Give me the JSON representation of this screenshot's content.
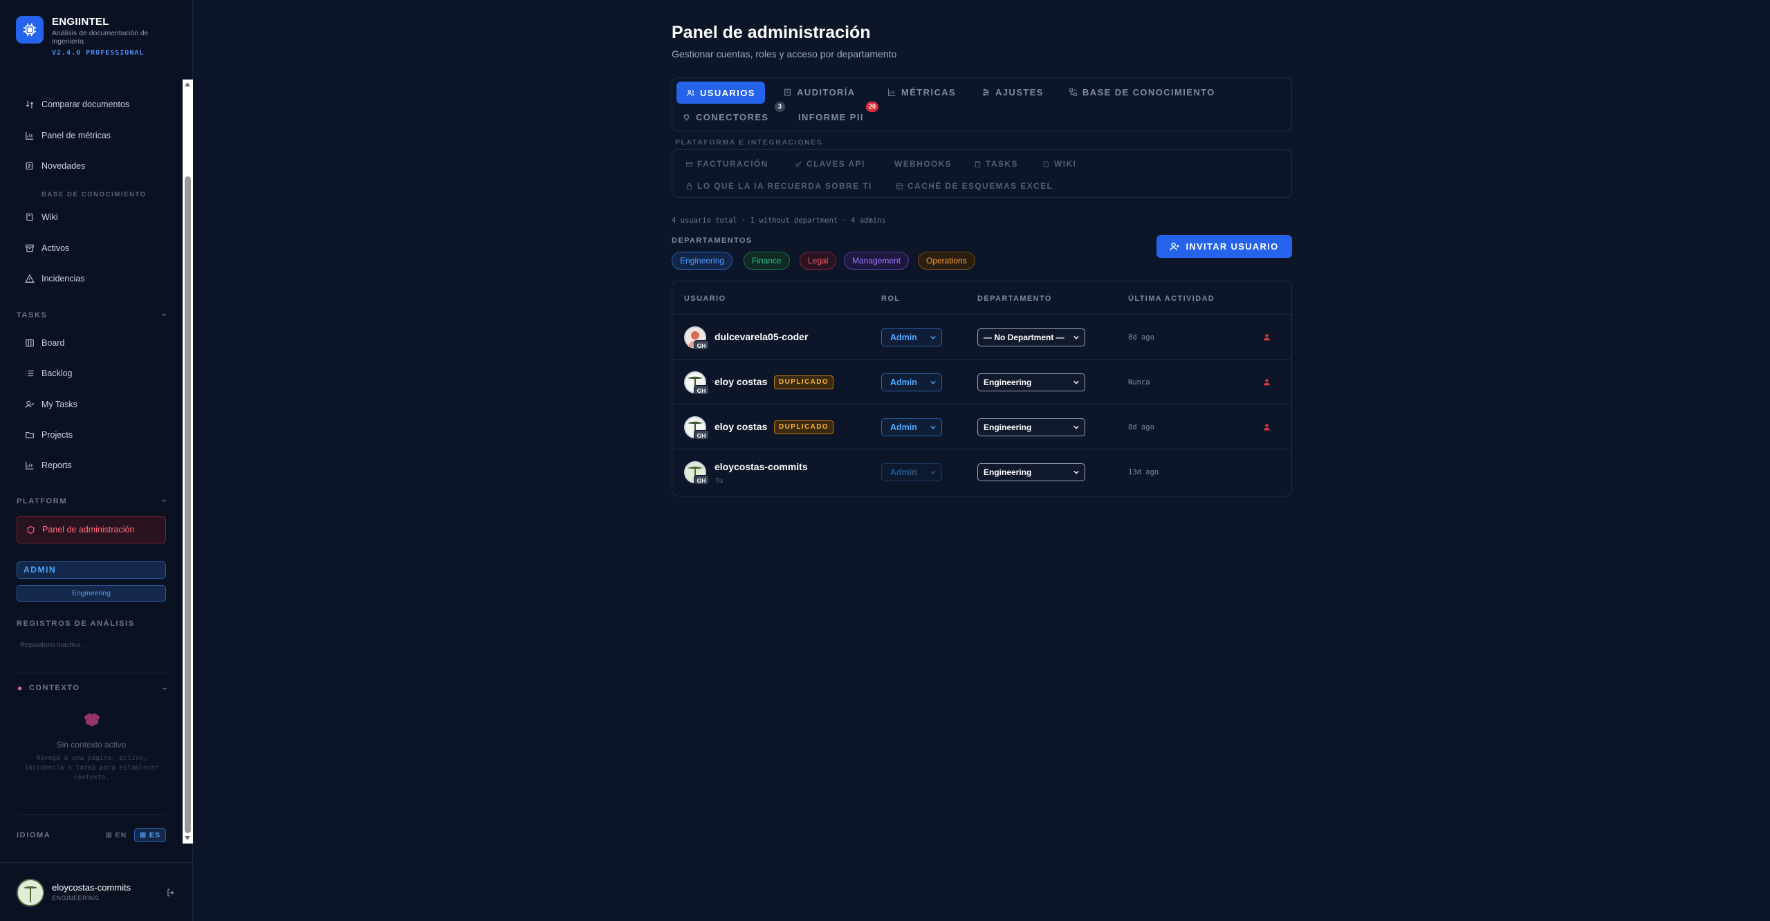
{
  "app": {
    "name": "ENGIINTEL",
    "subtitle": "Análisis de documentación de ingeniería",
    "version": "V2.4.0 PROFESSIONAL"
  },
  "sidebar": {
    "top_items": [
      {
        "label": "Comparar documentos",
        "icon": "compare-icon"
      },
      {
        "label": "Panel de métricas",
        "icon": "chart-icon"
      },
      {
        "label": "Novedades",
        "icon": "news-icon"
      }
    ],
    "kb_label": "BASE DE CONOCIMIENTO",
    "kb_items": [
      {
        "label": "Wiki",
        "icon": "book-icon"
      },
      {
        "label": "Activos",
        "icon": "archive-icon"
      },
      {
        "label": "Incidencias",
        "icon": "alert-icon"
      }
    ],
    "tasks_label": "TASKS",
    "tasks_items": [
      {
        "label": "Board",
        "icon": "board-icon"
      },
      {
        "label": "Backlog",
        "icon": "list-icon"
      },
      {
        "label": "My Tasks",
        "icon": "user-check-icon"
      },
      {
        "label": "Projects",
        "icon": "folder-icon"
      },
      {
        "label": "Reports",
        "icon": "chart-icon"
      }
    ],
    "platform_label": "PLATFORM",
    "admin_item": "Panel de administración",
    "role": "ADMIN",
    "department": "Engineering",
    "logs_label": "REGISTROS DE ANÁLISIS",
    "repo_inactive": "Repositorio inactivo...",
    "context_label": "CONTEXTO",
    "context_toggle": "–",
    "context_none": "Sin contexto activo",
    "context_desc": "Navega a una página, activo, incidencia o tarea para establecer contexto.",
    "language_label": "IDIOMA",
    "languages": [
      "EN",
      "ES"
    ],
    "active_language": "ES",
    "user": {
      "name": "eloycostas-commits",
      "department": "ENGINEERING"
    }
  },
  "main": {
    "title": "Panel de administración",
    "subtitle": "Gestionar cuentas, roles y acceso por departamento",
    "tabs": [
      {
        "label": "USUARIOS",
        "active": true
      },
      {
        "label": "AUDITORÍA"
      },
      {
        "label": "MÉTRICAS"
      },
      {
        "label": "AJUSTES"
      },
      {
        "label": "BASE DE CONOCIMIENTO"
      },
      {
        "label": "CONECTORES",
        "count": "3"
      },
      {
        "label": "INFORME PII",
        "count": "20"
      }
    ],
    "platform_label": "PLATAFORMA E INTEGRACIONES",
    "platform_items": [
      "FACTURACIÓN",
      "CLAVES API",
      "WEBHOOKS",
      "TASKS",
      "WIKI",
      "LO QUE LA IA RECUERDA SOBRE TI",
      "CACHÉ DE ESQUEMAS EXCEL"
    ],
    "summary": "4 usuario total · 1 without department · 4 admins",
    "departments_label": "DEPARTAMENTOS",
    "departments": [
      {
        "name": "Engineering",
        "color": "#4f9cff"
      },
      {
        "name": "Finance",
        "color": "#2fbf7a"
      },
      {
        "name": "Legal",
        "color": "#ff5a6a"
      },
      {
        "name": "Management",
        "color": "#a078ff"
      },
      {
        "name": "Operations",
        "color": "#ff9f2d"
      }
    ],
    "invite_label": "INVITAR USUARIO",
    "table": {
      "headers": [
        "USUARIO",
        "ROL",
        "DEPARTAMENTO",
        "ÚLTIMA ACTIVIDAD"
      ],
      "rows": [
        {
          "name": "dulcevarela05-coder",
          "role": "Admin",
          "department": "— No Department —",
          "activity": "8d ago",
          "duplicate": "",
          "you": ""
        },
        {
          "name": "eloy costas",
          "role": "Admin",
          "department": "Engineering",
          "activity": "Nunca",
          "duplicate": "DUPLICADO",
          "you": ""
        },
        {
          "name": "eloy costas",
          "role": "Admin",
          "department": "Engineering",
          "activity": "8d ago",
          "duplicate": "DUPLICADO",
          "you": ""
        },
        {
          "name": "eloycostas-commits",
          "role": "Admin",
          "department": "Engineering",
          "activity": "13d ago",
          "duplicate": "",
          "you": "Tú"
        }
      ],
      "badge": "GH"
    }
  }
}
